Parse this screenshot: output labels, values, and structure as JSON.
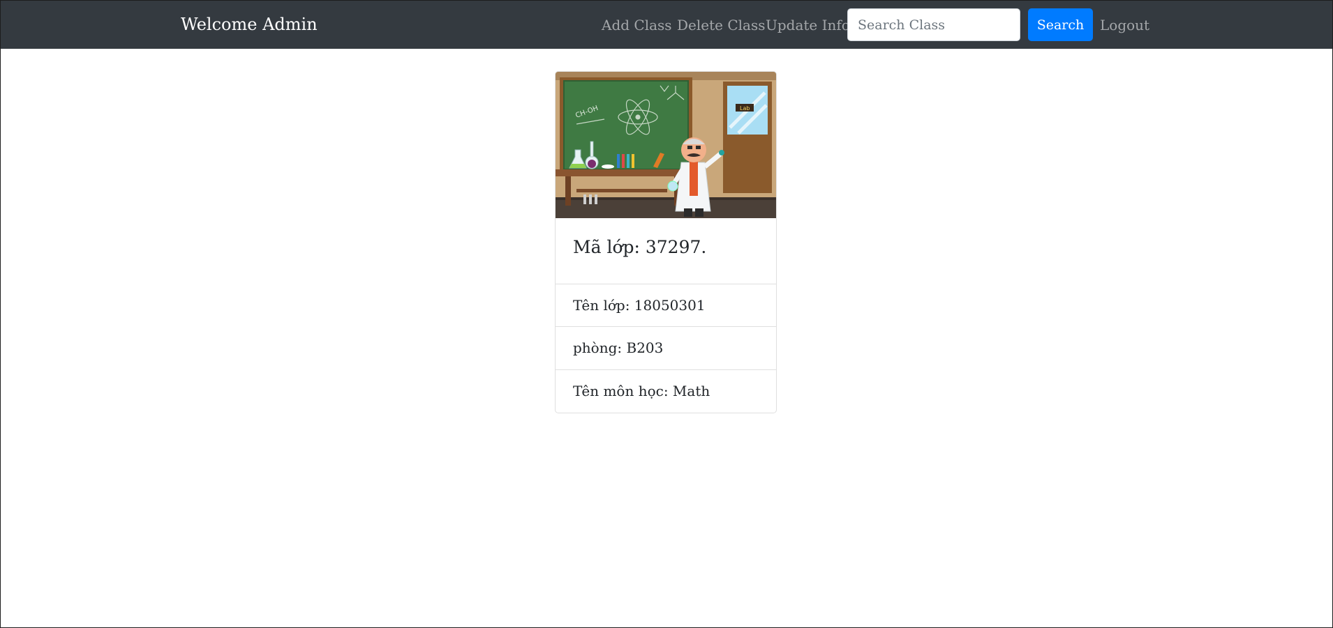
{
  "navbar": {
    "brand": "Welcome Admin",
    "links": {
      "add_class": "Add Class",
      "delete_class": "Delete Class",
      "update_info": "Update Info",
      "logout": "Logout"
    },
    "search": {
      "placeholder": "Search Class",
      "value": "",
      "button_label": "Search"
    }
  },
  "card": {
    "image": "laboratory-scientist-illustration",
    "title": "Mã lớp: 37297.",
    "items": [
      "Tên lớp: 18050301",
      "phòng: B203",
      "Tên môn học: Math"
    ],
    "image_lettering": [
      "CH-OH",
      "Lab"
    ]
  },
  "colors": {
    "navbar_bg": "#343a40",
    "primary": "#007bff",
    "nav_link": "rgba(255,255,255,0.55)"
  }
}
